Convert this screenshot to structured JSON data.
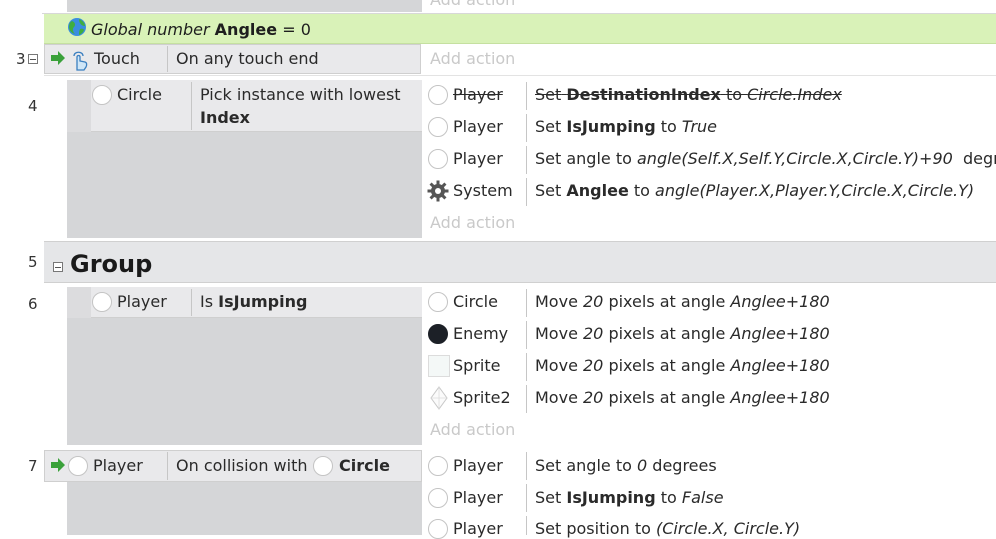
{
  "top_add_action": "Add action",
  "global_var": {
    "prefix": "Global number",
    "name": "Anglee",
    "eq": "=",
    "value": "0"
  },
  "event3": {
    "number": "3",
    "object": "Touch",
    "condition": "On any touch end",
    "add_action": "Add action"
  },
  "event4": {
    "number": "4",
    "object": "Circle",
    "condition_text": "Pick instance with lowest",
    "condition_bold": "Index",
    "actions": [
      {
        "object": "Player",
        "text": "Set",
        "bold": "DestinationIndex",
        "mid": "to",
        "italic": "Circle.Index"
      },
      {
        "object": "Player",
        "text": "Set",
        "bold": "IsJumping",
        "mid": "to",
        "italic": "True"
      },
      {
        "object": "Player",
        "text": "Set angle to",
        "italic": "angle(Self.X,Self.Y,Circle.X,Circle.Y)+90",
        "tail": "degrees"
      },
      {
        "object": "System",
        "text": "Set",
        "bold": "Anglee",
        "mid": "to",
        "italic": "angle(Player.X,Player.Y,Circle.X,Circle.Y)"
      }
    ],
    "add_action": "Add action"
  },
  "group": {
    "number": "5",
    "title": "Group"
  },
  "event6": {
    "number": "6",
    "object": "Player",
    "condition_text": "Is",
    "condition_bold": "IsJumping",
    "actions": [
      {
        "object": "Circle",
        "pre": "Move",
        "italic1": "20",
        "mid": "pixels at angle",
        "italic2": "Anglee+180"
      },
      {
        "object": "Enemy",
        "pre": "Move",
        "italic1": "20",
        "mid": "pixels at angle",
        "italic2": "Anglee+180"
      },
      {
        "object": "Sprite",
        "pre": "Move",
        "italic1": "20",
        "mid": "pixels at angle",
        "italic2": "Anglee+180"
      },
      {
        "object": "Sprite2",
        "pre": "Move",
        "italic1": "20",
        "mid": "pixels at angle",
        "italic2": "Anglee+180"
      }
    ],
    "add_action": "Add action"
  },
  "event7": {
    "number": "7",
    "object": "Player",
    "condition_text": "On collision with",
    "condition_target": "Circle",
    "actions": [
      {
        "object": "Player",
        "text": "Set angle to",
        "italic": "0",
        "tail": "degrees"
      },
      {
        "object": "Player",
        "text": "Set",
        "bold": "IsJumping",
        "mid": "to",
        "italic": "False"
      },
      {
        "object": "Player",
        "text": "Set position to",
        "italic": "(Circle.X, Circle.Y)"
      }
    ]
  }
}
